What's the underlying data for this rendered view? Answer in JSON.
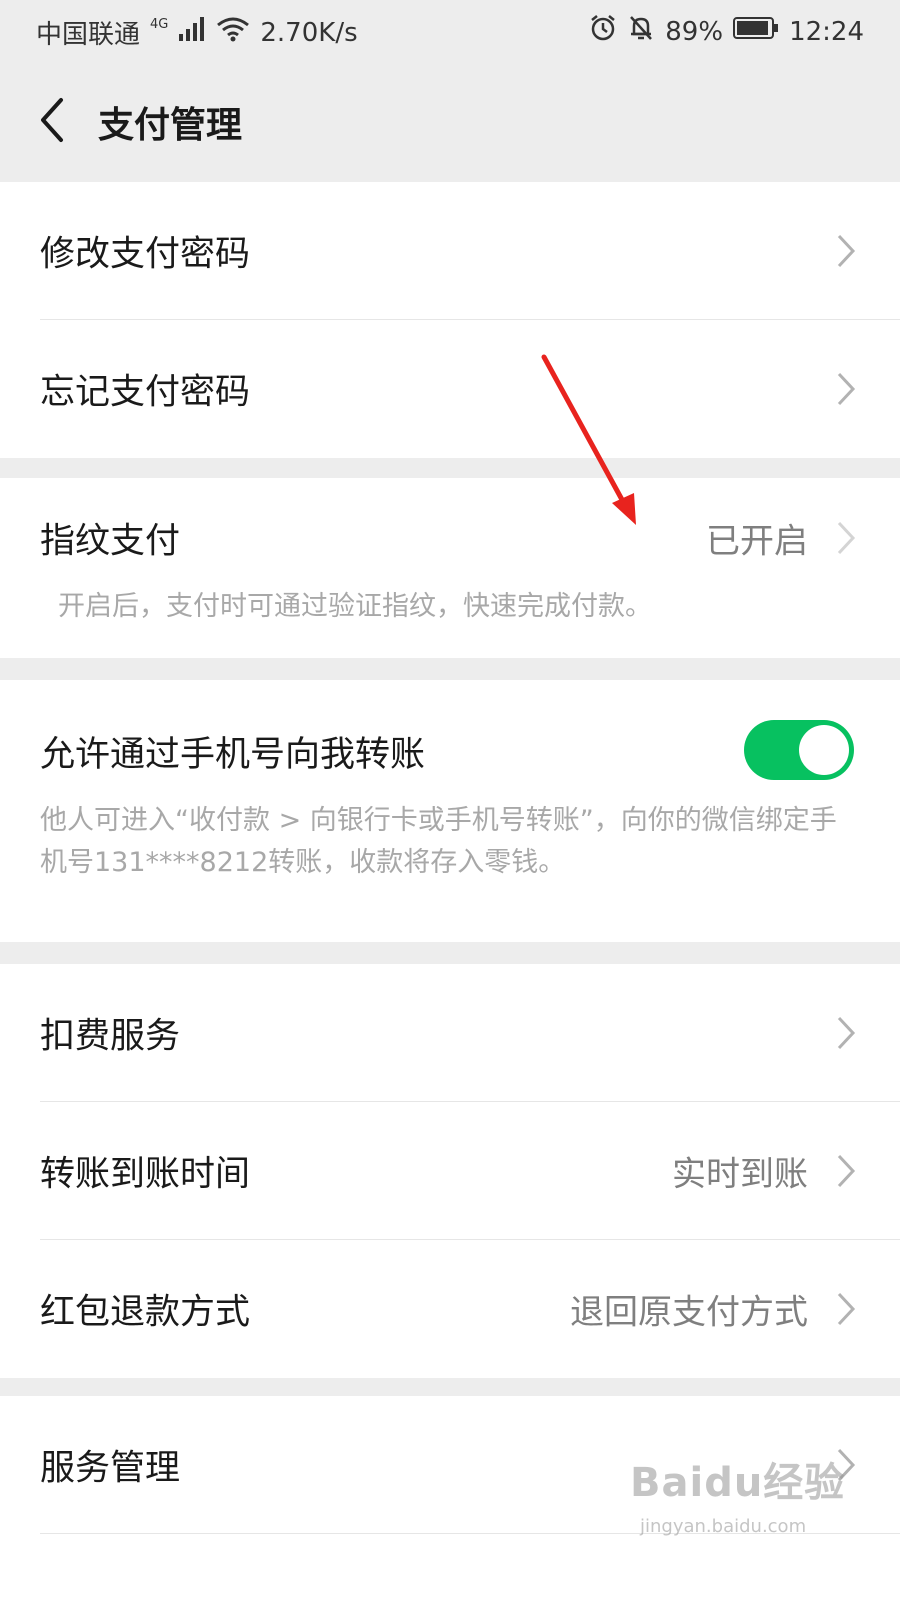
{
  "status_bar": {
    "carrier": "中国联通",
    "network_type": "4G",
    "speed": "2.70K/s",
    "battery": "89%",
    "time": "12:24",
    "icons": [
      "signal-icon",
      "wifi-icon",
      "alarm-icon",
      "mute-bell-icon",
      "battery-icon"
    ]
  },
  "header": {
    "title": "支付管理",
    "back_icon": "chevron-left-icon"
  },
  "section1": {
    "rows": [
      {
        "label": "修改支付密码"
      },
      {
        "label": "忘记支付密码"
      }
    ]
  },
  "fingerprint": {
    "label": "指纹支付",
    "value": "已开启",
    "description": "开启后，支付时可通过验证指纹，快速完成付款。"
  },
  "phone_transfer": {
    "label": "允许通过手机号向我转账",
    "enabled": true,
    "description": "他人可进入“收付款 > 向银行卡或手机号转账”，向你的微信绑定手机号131****8212转账，收款将存入零钱。"
  },
  "section4": {
    "rows": [
      {
        "label": "扣费服务",
        "value": ""
      },
      {
        "label": "转账到账时间",
        "value": "实时到账"
      },
      {
        "label": "红包退款方式",
        "value": "退回原支付方式"
      }
    ]
  },
  "section5": {
    "rows": [
      {
        "label": "服务管理"
      }
    ]
  },
  "watermark": {
    "main": "Baidu经验",
    "sub": "jingyan.baidu.com"
  },
  "colors": {
    "background": "#ededed",
    "toggle_on": "#07c160",
    "annotation_arrow": "#e8231e",
    "secondary_text": "#7f7f7f",
    "hint_text": "#a8a8a8"
  }
}
